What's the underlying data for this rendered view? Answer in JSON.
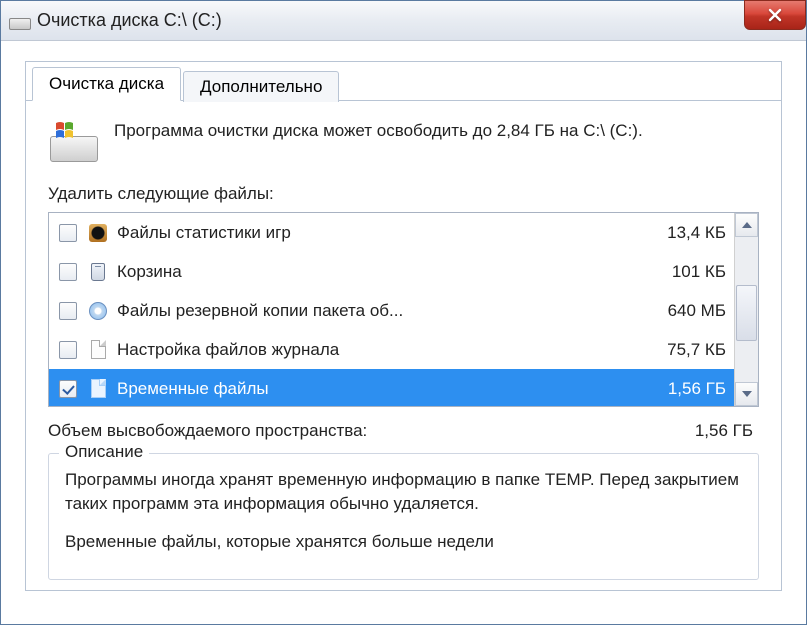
{
  "window": {
    "title": "Очистка диска C:\\ (C:)"
  },
  "tabs": {
    "cleanup": "Очистка диска",
    "more": "Дополнительно"
  },
  "intro": "Программа очистки диска может освободить до 2,84 ГБ на C:\\ (C:).",
  "list_label": "Удалить следующие файлы:",
  "items": [
    {
      "label": "Файлы статистики игр",
      "size": "13,4 КБ",
      "checked": false,
      "icon": "ace"
    },
    {
      "label": "Корзина",
      "size": "101 КБ",
      "checked": false,
      "icon": "bin"
    },
    {
      "label": "Файлы резервной копии пакета об...",
      "size": "640 МБ",
      "checked": false,
      "icon": "cd"
    },
    {
      "label": "Настройка файлов журнала",
      "size": "75,7 КБ",
      "checked": false,
      "icon": "file"
    },
    {
      "label": "Временные файлы",
      "size": "1,56 ГБ",
      "checked": true,
      "icon": "file",
      "selected": true
    }
  ],
  "total": {
    "label": "Объем высвобождаемого пространства:",
    "value": "1,56 ГБ"
  },
  "description": {
    "title": "Описание",
    "body1": "Программы иногда хранят временную информацию в папке TEMP. Перед закрытием таких программ эта информация обычно удаляется.",
    "body2": "Временные файлы, которые хранятся больше недели"
  }
}
